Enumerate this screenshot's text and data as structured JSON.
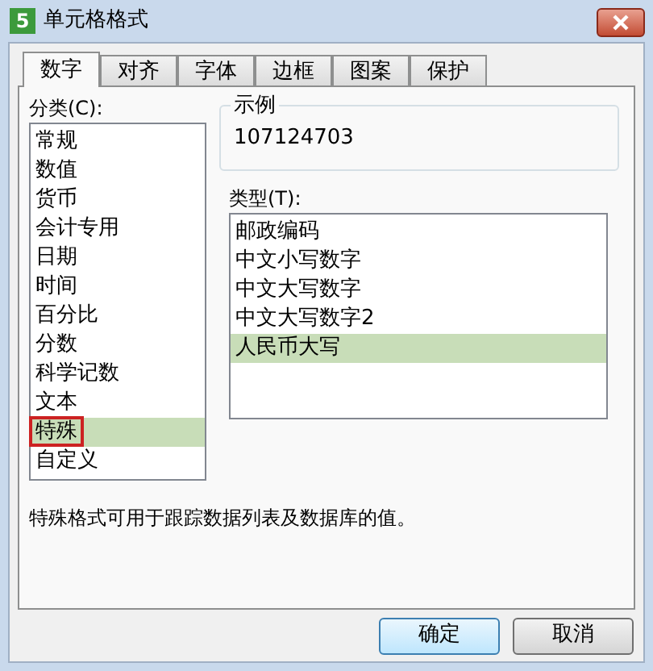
{
  "window": {
    "title": "单元格格式",
    "app_icon": "5"
  },
  "tabs": [
    {
      "label": "数字",
      "selected": true
    },
    {
      "label": "对齐",
      "selected": false
    },
    {
      "label": "字体",
      "selected": false
    },
    {
      "label": "边框",
      "selected": false
    },
    {
      "label": "图案",
      "selected": false
    },
    {
      "label": "保护",
      "selected": false
    }
  ],
  "category": {
    "label": "分类(C):",
    "items": [
      {
        "label": "常规",
        "selected": false,
        "highlighted": false
      },
      {
        "label": "数值",
        "selected": false,
        "highlighted": false
      },
      {
        "label": "货币",
        "selected": false,
        "highlighted": false
      },
      {
        "label": "会计专用",
        "selected": false,
        "highlighted": false
      },
      {
        "label": "日期",
        "selected": false,
        "highlighted": false
      },
      {
        "label": "时间",
        "selected": false,
        "highlighted": false
      },
      {
        "label": "百分比",
        "selected": false,
        "highlighted": false
      },
      {
        "label": "分数",
        "selected": false,
        "highlighted": false
      },
      {
        "label": "科学记数",
        "selected": false,
        "highlighted": false
      },
      {
        "label": "文本",
        "selected": false,
        "highlighted": false
      },
      {
        "label": "特殊",
        "selected": true,
        "highlighted": true
      },
      {
        "label": "自定义",
        "selected": false,
        "highlighted": false
      }
    ]
  },
  "sample": {
    "label": "示例",
    "value": "107124703"
  },
  "type": {
    "label": "类型(T):",
    "items": [
      {
        "label": "邮政编码",
        "selected": false
      },
      {
        "label": "中文小写数字",
        "selected": false
      },
      {
        "label": "中文大写数字",
        "selected": false
      },
      {
        "label": "中文大写数字2",
        "selected": false
      },
      {
        "label": "人民币大写",
        "selected": true
      }
    ]
  },
  "description": "特殊格式可用于跟踪数据列表及数据库的值。",
  "buttons": [
    {
      "label": "确定",
      "default": true
    },
    {
      "label": "取消",
      "default": false
    }
  ]
}
